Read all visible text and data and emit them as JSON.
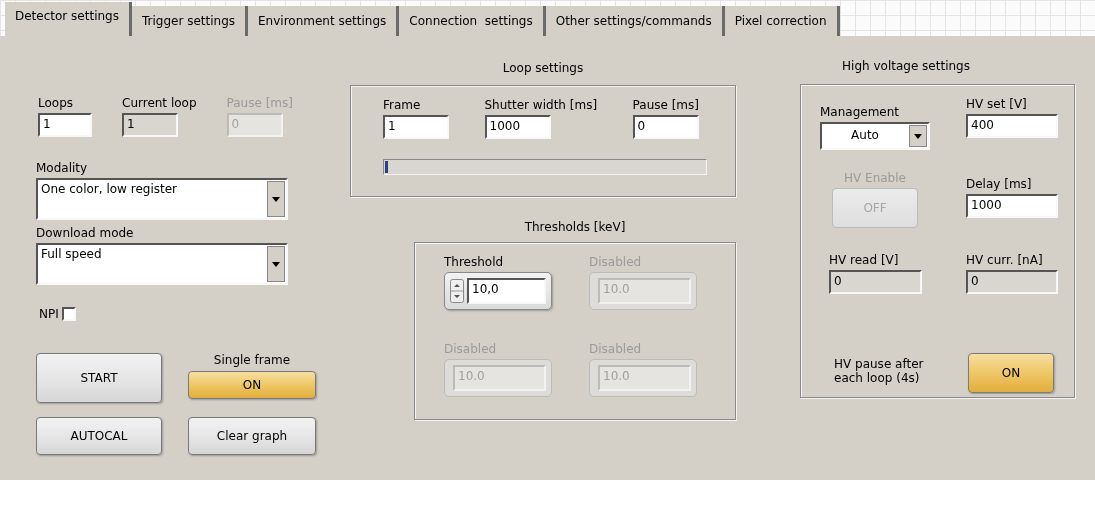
{
  "tabs": [
    {
      "label": "Detector settings",
      "selected": true
    },
    {
      "label": "Trigger settings",
      "selected": false
    },
    {
      "label": "Environment settings",
      "selected": false
    },
    {
      "label": "Connection  settings",
      "selected": false
    },
    {
      "label": "Other settings/commands",
      "selected": false
    },
    {
      "label": "Pixel correction",
      "selected": false
    }
  ],
  "run": {
    "fields": [
      {
        "label": "Loops",
        "value": "1",
        "kind": "input",
        "disabled": false
      },
      {
        "label": "Current loop",
        "value": "1",
        "kind": "indicator",
        "disabled": false
      },
      {
        "label": "Pause [ms]",
        "value": "0",
        "kind": "indicator",
        "disabled": true
      }
    ],
    "modality": {
      "label": "Modality",
      "value": "One color, low register"
    },
    "download_mode": {
      "label": "Download mode",
      "value": "Full speed"
    },
    "npi": {
      "label": "NPI",
      "checked": false
    },
    "start_button": "START",
    "autocal_button": "AUTOCAL",
    "single_frame": {
      "label": "Single frame",
      "value": "ON",
      "on": true
    },
    "clear_button": "Clear graph"
  },
  "loop_settings": {
    "title": "Loop settings",
    "fields": [
      {
        "label": "Frame",
        "value": "1",
        "kind": "input",
        "disabled": false
      },
      {
        "label": "Shutter width [ms]",
        "value": "1000",
        "kind": "input",
        "disabled": false
      },
      {
        "label": "Pause [ms]",
        "value": "0",
        "kind": "input",
        "disabled": false
      }
    ],
    "progress": {
      "level": 0.01
    }
  },
  "thresholds": {
    "title": "Thresholds [keV]",
    "items": [
      {
        "label": "Threshold",
        "value": "10,0",
        "disabled": false
      },
      {
        "label": "Disabled",
        "value": "10.0",
        "disabled": true
      },
      {
        "label": "Disabled",
        "value": "10.0",
        "disabled": true
      },
      {
        "label": "Disabled",
        "value": "10.0",
        "disabled": true
      }
    ]
  },
  "high_voltage": {
    "title": "High voltage settings",
    "management": {
      "label": "Management",
      "value": "Auto"
    },
    "hv_set": {
      "label": "HV set [V]",
      "value": "400",
      "kind": "input",
      "disabled": false
    },
    "hv_enable": {
      "label": "HV Enable",
      "value": "OFF",
      "on": false,
      "disabled": true
    },
    "delay": {
      "label": "Delay [ms]",
      "value": "1000",
      "kind": "input",
      "disabled": false
    },
    "hv_read": {
      "label": "HV read [V]",
      "value": "0",
      "kind": "indicator",
      "disabled": false
    },
    "hv_curr": {
      "label": "HV curr. [nA]",
      "value": "0",
      "kind": "indicator",
      "disabled": false
    },
    "hv_pause": {
      "label": "HV pause after\neach loop (4s)",
      "value": "ON",
      "on": true,
      "disabled": false
    }
  }
}
